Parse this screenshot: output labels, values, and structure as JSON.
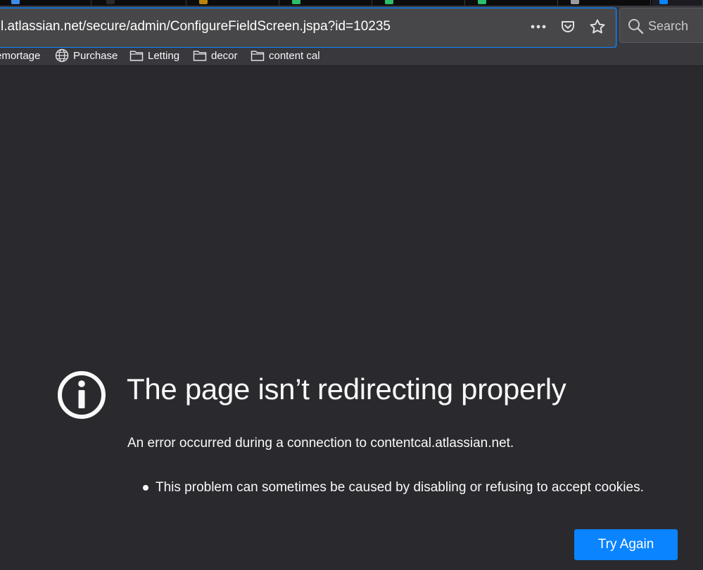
{
  "browser": {
    "tabs": [
      {
        "favicon_color": "#3d8be8",
        "active": false
      },
      {
        "favicon_color": "#2a2a2e",
        "active": false
      },
      {
        "favicon_color": "#b8860b",
        "active": false
      },
      {
        "favicon_color": "#2bbf6a",
        "active": false
      },
      {
        "favicon_color": "#2bbf6a",
        "active": false
      },
      {
        "favicon_color": "#2bbf6a",
        "active": false
      },
      {
        "favicon_color": "#9a9aa0",
        "active": false
      },
      {
        "favicon_color": "#0a84ff",
        "active": true
      }
    ],
    "url": "l.atlassian.net/secure/admin/ConfigureFieldScreen.jspa?id=10235",
    "page_actions": {
      "more": "more-actions-icon",
      "pocket": "pocket-icon",
      "bookmark": "star-icon"
    },
    "search": {
      "placeholder": "Search",
      "icon": "search-icon"
    },
    "bookmarks": [
      {
        "label": "emortage",
        "icon": "none"
      },
      {
        "label": "Purchase",
        "icon": "globe-icon"
      },
      {
        "label": "Letting",
        "icon": "folder-icon"
      },
      {
        "label": "decor",
        "icon": "folder-icon"
      },
      {
        "label": "content cal",
        "icon": "folder-icon"
      }
    ]
  },
  "error_page": {
    "icon": "info-icon",
    "title": "The page isn’t redirecting properly",
    "description": "An error occurred during a connection to contentcal.atlassian.net.",
    "bullets": [
      "This problem can sometimes be caused by disabling or refusing to accept cookies."
    ],
    "try_again_label": "Try Again"
  },
  "colors": {
    "background": "#2a2a2e",
    "toolbar": "#38383d",
    "accent": "#0a84ff",
    "text": "#f9f9fa"
  }
}
